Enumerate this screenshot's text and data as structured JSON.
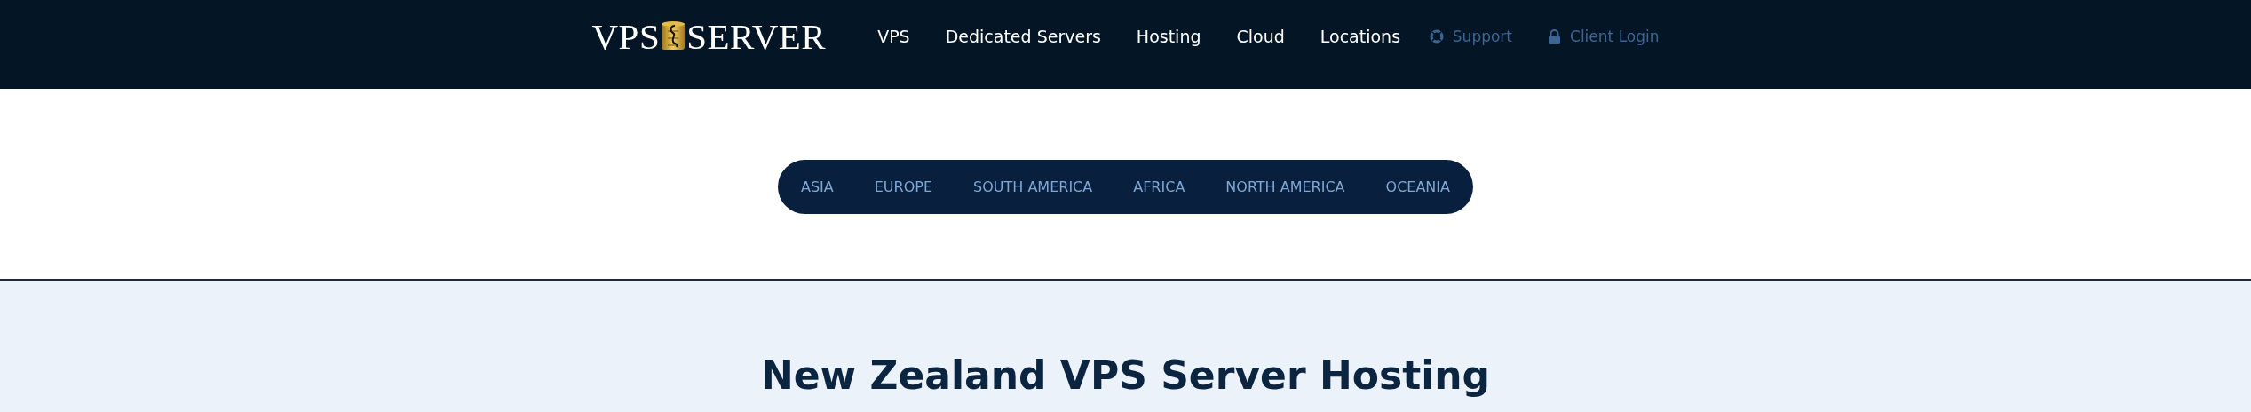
{
  "header": {
    "logo": {
      "left": "VPS",
      "right": "SERVER"
    },
    "nav": [
      {
        "label": "VPS"
      },
      {
        "label": "Dedicated Servers"
      },
      {
        "label": "Hosting"
      },
      {
        "label": "Cloud"
      },
      {
        "label": "Locations"
      }
    ],
    "links": [
      {
        "kind": "support",
        "label": "Support"
      },
      {
        "kind": "login",
        "label": "Client Login"
      }
    ]
  },
  "regions": [
    {
      "label": "ASIA"
    },
    {
      "label": "EUROPE"
    },
    {
      "label": "SOUTH AMERICA"
    },
    {
      "label": "AFRICA"
    },
    {
      "label": "NORTH AMERICA"
    },
    {
      "label": "OCEANIA"
    }
  ],
  "heading": "New Zealand VPS Server Hosting"
}
